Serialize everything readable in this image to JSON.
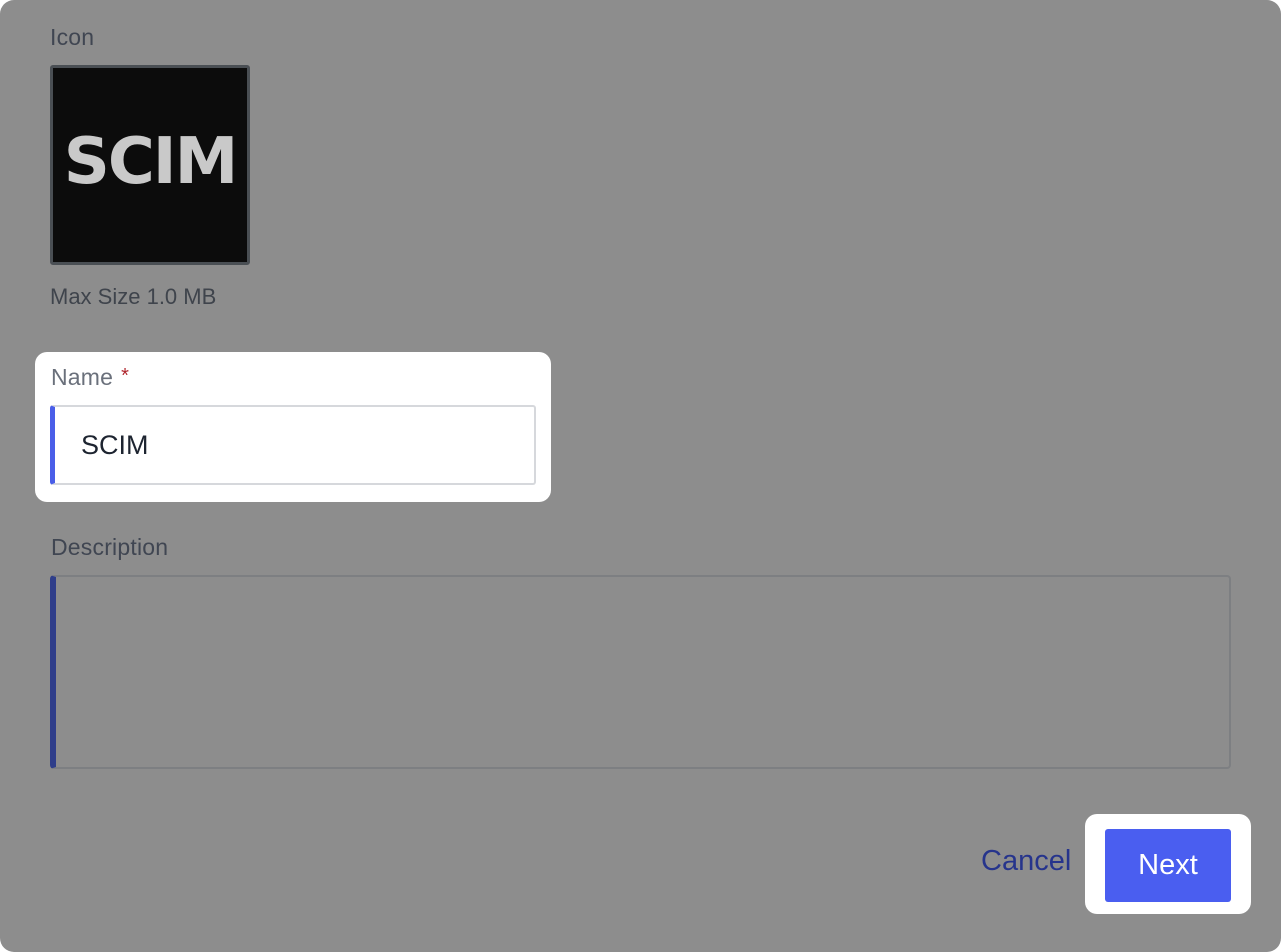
{
  "form": {
    "icon_label": "Icon",
    "icon_name": "scim-logo-icon",
    "icon_text": "SCIM",
    "max_size_text": "Max Size 1.0 MB",
    "name": {
      "label": "Name",
      "required_marker": "*",
      "value": "SCIM"
    },
    "description": {
      "label": "Description",
      "value": ""
    }
  },
  "actions": {
    "cancel_label": "Cancel",
    "next_label": "Next"
  },
  "colors": {
    "overlay": "#8d8d8d",
    "primary": "#4a5ef0",
    "link": "#26348c",
    "required": "#b0262d"
  }
}
